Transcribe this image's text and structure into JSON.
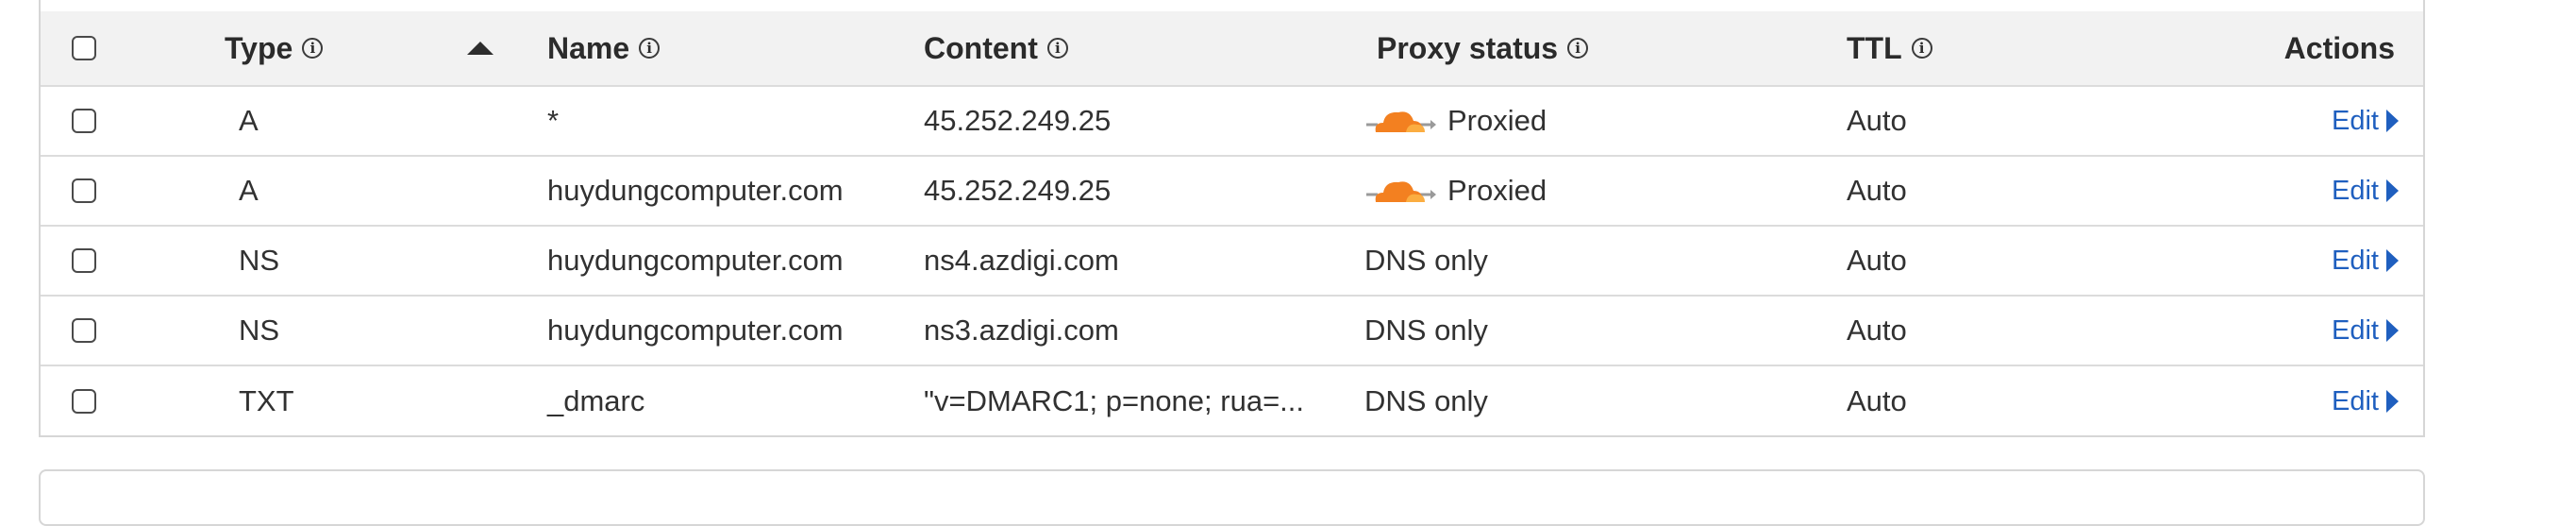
{
  "table": {
    "columns": {
      "type": "Type",
      "name": "Name",
      "content": "Content",
      "proxy_status": "Proxy status",
      "ttl": "TTL",
      "actions": "Actions"
    },
    "info_glyph": "ⓘ",
    "rows": [
      {
        "type": "A",
        "name": "*",
        "content": "45.252.249.25",
        "proxy": "Proxied",
        "ttl": "Auto",
        "action": "Edit"
      },
      {
        "type": "A",
        "name": "huydungcomputer.com",
        "content": "45.252.249.25",
        "proxy": "Proxied",
        "ttl": "Auto",
        "action": "Edit"
      },
      {
        "type": "NS",
        "name": "huydungcomputer.com",
        "content": "ns4.azdigi.com",
        "proxy": "DNS only",
        "ttl": "Auto",
        "action": "Edit"
      },
      {
        "type": "NS",
        "name": "huydungcomputer.com",
        "content": "ns3.azdigi.com",
        "proxy": "DNS only",
        "ttl": "Auto",
        "action": "Edit"
      },
      {
        "type": "TXT",
        "name": "_dmarc",
        "content": "\"v=DMARC1; p=none; rua=...",
        "proxy": "DNS only",
        "ttl": "Auto",
        "action": "Edit"
      }
    ]
  },
  "colors": {
    "proxied_cloud": "#f38020",
    "link": "#1f5fbf",
    "header_bg": "#f2f2f2"
  },
  "icons": {
    "info": "info-icon",
    "sort": "sort-ascending-icon",
    "cloud": "cloudflare-proxied-cloud-icon",
    "edit": "caret-right-icon"
  }
}
